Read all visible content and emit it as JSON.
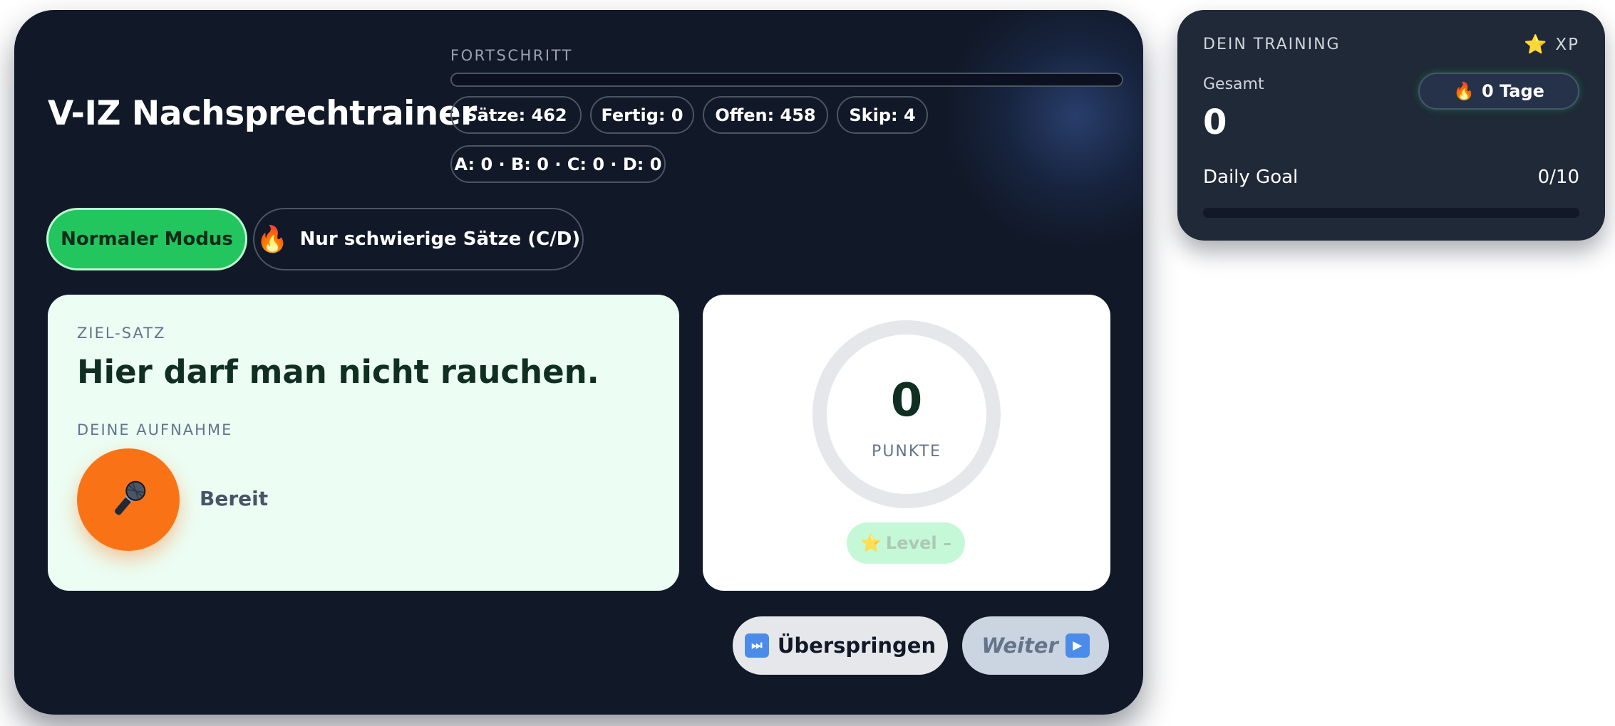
{
  "app": {
    "title": "V-IZ Nachsprechtrainer"
  },
  "progress": {
    "label": "FORTSCHRITT",
    "value": 0
  },
  "stats": {
    "saetze": "Sätze: 462",
    "fertig": "Fertig: 0",
    "offen": "Offen: 458",
    "skip": "Skip: 4",
    "grades": "A: 0 · B: 0 · C: 0 · D: 0"
  },
  "modes": {
    "normal": "Normaler Modus",
    "hard": "Nur schwierige Sätze (C/D)",
    "hard_icon": "flame-icon"
  },
  "target": {
    "label": "ZIEL-SATZ",
    "sentence": "Hier darf man nicht rauchen.",
    "recording_label": "DEINE AUFNAHME",
    "mic_icon": "microphone-icon",
    "status": "Bereit"
  },
  "score": {
    "value": "0",
    "unit": "PUNKTE",
    "level": "Level –",
    "level_icon": "star-icon"
  },
  "actions": {
    "skip": "Überspringen",
    "skip_icon": "fast-forward-icon",
    "next": "Weiter",
    "next_icon": "play-icon"
  },
  "training": {
    "title": "DEIN TRAINING",
    "xp": "XP",
    "xp_icon": "star-icon",
    "total_label": "Gesamt",
    "total_value": "0",
    "streak": "0 Tage",
    "streak_icon": "flame-icon",
    "daily_goal_label": "Daily Goal",
    "daily_goal_value": "0/10",
    "daily_goal_fraction": 0
  },
  "colors": {
    "background": "#111827",
    "accent_green": "#22c55e",
    "mic_orange": "#f97316",
    "panel_mint": "#ecfdf3",
    "side_card": "#1f2937"
  }
}
